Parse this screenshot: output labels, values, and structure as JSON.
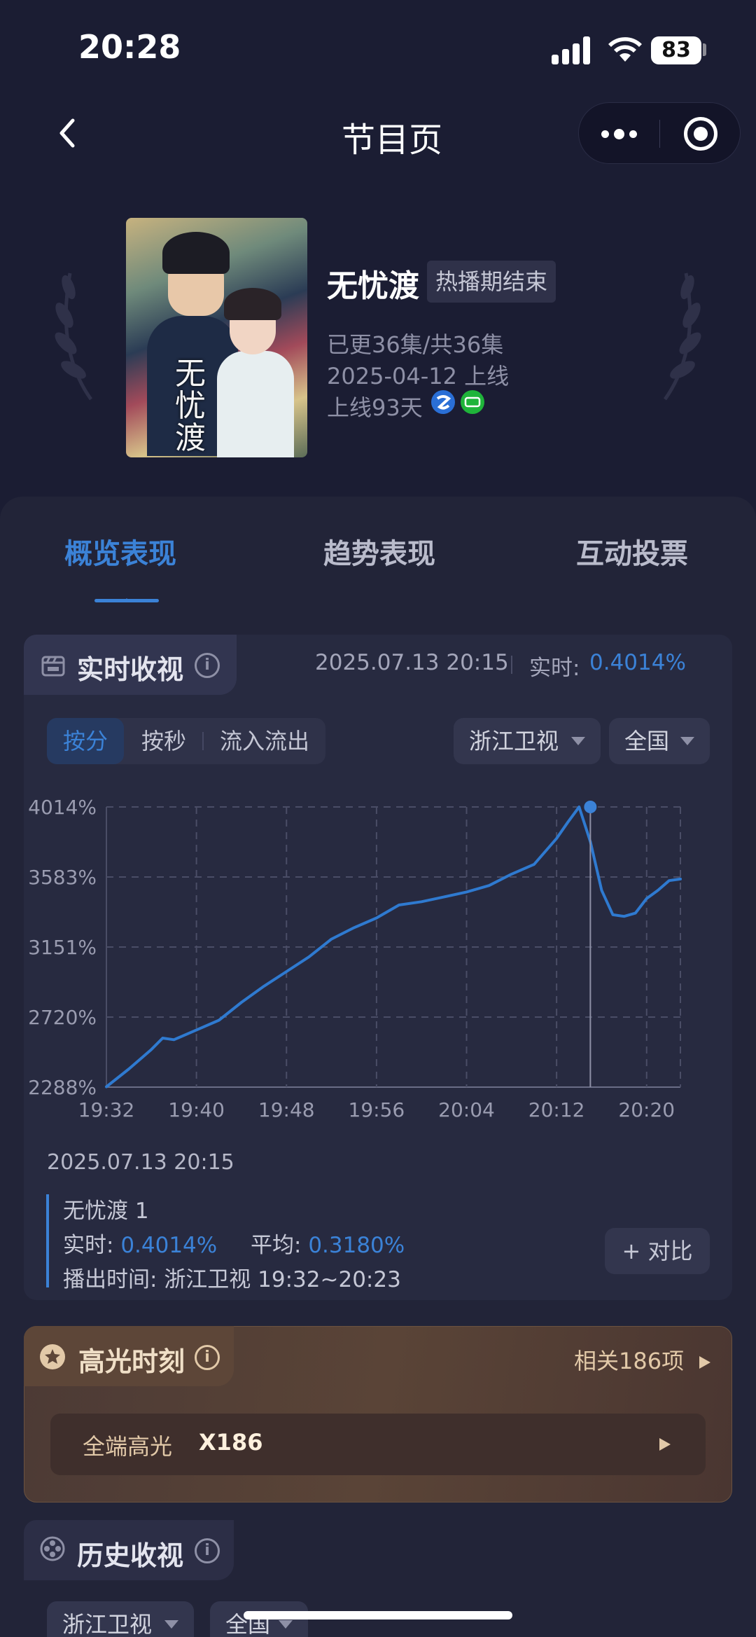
{
  "status_bar": {
    "time": "20:28",
    "battery": "83"
  },
  "nav": {
    "title": "节目页"
  },
  "show": {
    "title": "无忧渡",
    "status_chip": "热播期结束",
    "episodes": "已更36集/共36集",
    "air_date": "2025-04-12 上线",
    "days_online": "上线93天",
    "poster_title": "无忧渡"
  },
  "tabs": [
    "概览表现",
    "趋势表现",
    "互动投票"
  ],
  "realtime": {
    "title": "实时收视",
    "timestamp": "2025.07.13 20:15",
    "label": "实时:",
    "value": "0.4014%",
    "segments": [
      "按分",
      "按秒",
      "流入流出"
    ],
    "channel": "浙江卫视",
    "region": "全国"
  },
  "chart_data": {
    "type": "line",
    "y_ticks": [
      "0.4014%",
      "0.3583%",
      "0.3151%",
      "0.2720%",
      "0.2288%"
    ],
    "x_ticks": [
      "19:32",
      "19:40",
      "19:48",
      "19:56",
      "20:04",
      "20:12",
      "20:20"
    ],
    "ylim": [
      0.2288,
      0.4014
    ],
    "xlim": [
      "19:32",
      "20:23"
    ],
    "series": [
      {
        "x": [
          "19:32",
          "19:34",
          "19:36",
          "19:37",
          "19:38",
          "19:40",
          "19:42",
          "19:44",
          "19:46",
          "19:48",
          "19:50",
          "19:52",
          "19:54",
          "19:56",
          "19:58",
          "20:00",
          "20:02",
          "20:04",
          "20:06",
          "20:08",
          "20:10",
          "20:12",
          "20:13",
          "20:14",
          "20:15",
          "20:16",
          "20:17",
          "20:18",
          "20:19",
          "20:20",
          "20:21",
          "20:22",
          "20:23"
        ],
        "y": [
          0.229,
          0.24,
          0.252,
          0.259,
          0.258,
          0.264,
          0.27,
          0.281,
          0.291,
          0.3,
          0.309,
          0.32,
          0.327,
          0.333,
          0.341,
          0.343,
          0.346,
          0.349,
          0.353,
          0.36,
          0.366,
          0.382,
          0.392,
          0.4014,
          0.38,
          0.35,
          0.335,
          0.334,
          0.336,
          0.345,
          0.35,
          0.356,
          0.357
        ]
      }
    ],
    "marker": {
      "x": "20:15",
      "y": 0.4014
    },
    "grid": true
  },
  "detail": {
    "date": "2025.07.13 20:15",
    "name": "无忧渡 1",
    "rt_label": "实时:",
    "rt_value": "0.4014%",
    "avg_label": "平均:",
    "avg_value": "0.3180%",
    "airtime_label": "播出时间:",
    "airtime_value": "浙江卫视 19:32~20:23",
    "compare": "+ 对比"
  },
  "highlight": {
    "title": "高光时刻",
    "related": "相关186项",
    "row_label": "全端高光",
    "row_count": "X186"
  },
  "history": {
    "title": "历史收视",
    "channel": "浙江卫视",
    "region": "全国"
  },
  "colors": {
    "accent": "#3b82d7",
    "background": "#1b1d33",
    "card": "#222438"
  }
}
